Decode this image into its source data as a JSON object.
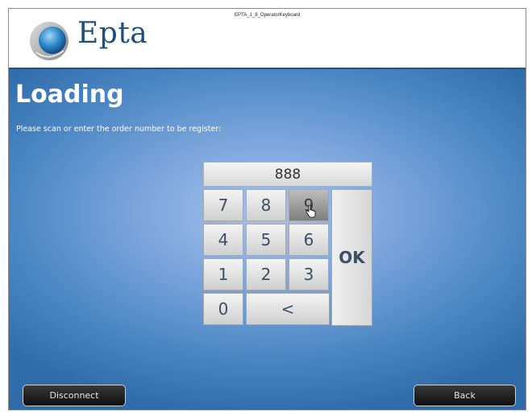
{
  "header": {
    "brand": "Epta",
    "screen_id": "EPTA_1_8_OperatorKeyboard"
  },
  "page": {
    "title": "Loading",
    "prompt": "Please scan or enter the order number to be register:"
  },
  "keypad": {
    "display_value": "888",
    "keys": {
      "k7": "7",
      "k8": "8",
      "k9": "9",
      "k4": "4",
      "k5": "5",
      "k6": "6",
      "k1": "1",
      "k2": "2",
      "k3": "3",
      "k0": "0",
      "backspace": "<",
      "ok": "OK"
    },
    "pressed_key": "9"
  },
  "footer": {
    "disconnect_label": "Disconnect",
    "back_label": "Back"
  },
  "colors": {
    "brand_blue": "#1f4e7a",
    "background_light": "#a6c2ec",
    "background_dark": "#2f6aa9",
    "key_text": "#3b4f66"
  },
  "icons": {
    "logo": "epta-sphere-logo",
    "cursor": "hand-pointer-icon"
  }
}
